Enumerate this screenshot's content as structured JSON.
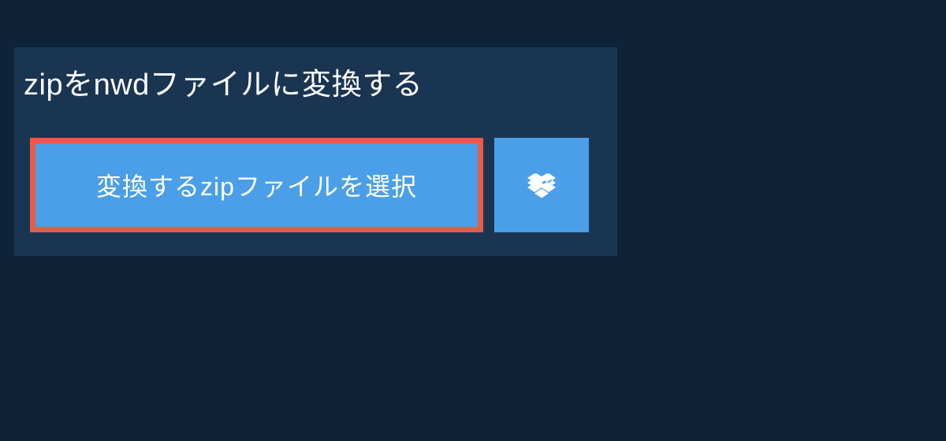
{
  "heading": "zipをnwdファイルに変換する",
  "selectButton": {
    "label": "変換するzipファイルを選択"
  },
  "dropboxButton": {
    "iconName": "dropbox"
  }
}
